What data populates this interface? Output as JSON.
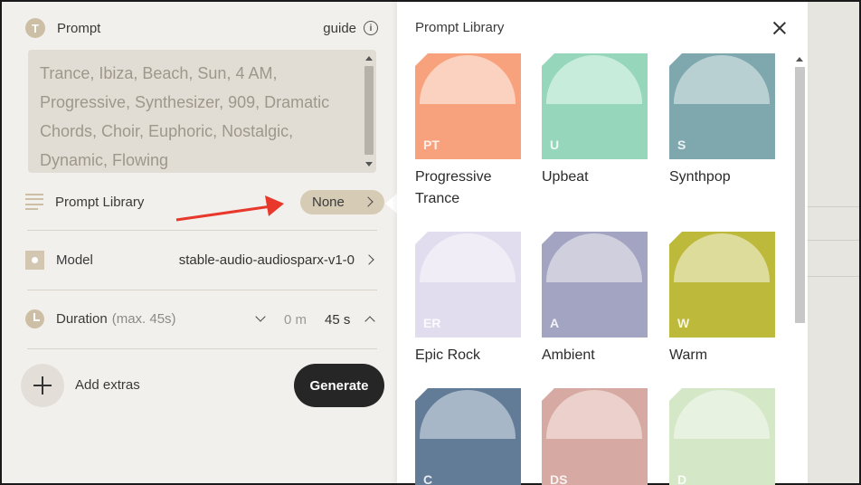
{
  "prompt": {
    "icon": "T",
    "label": "Prompt",
    "guide_label": "guide",
    "placeholder": "Trance, Ibiza, Beach, Sun, 4 AM, Progressive, Synthesizer, 909, Dramatic Chords, Choir, Euphoric, Nostalgic, Dynamic, Flowing"
  },
  "prompt_library_row": {
    "label": "Prompt Library",
    "value": "None"
  },
  "model": {
    "label": "Model",
    "value": "stable-audio-audiosparx-v1-0"
  },
  "duration": {
    "label": "Duration",
    "hint": "(max. 45s)",
    "minutes": "0 m",
    "seconds": "45 s"
  },
  "extras": {
    "label": "Add extras"
  },
  "generate": {
    "label": "Generate"
  },
  "library": {
    "title": "Prompt Library",
    "tiles": [
      {
        "abbr": "PT",
        "name": "Progressive Trance",
        "color": "#f7a27c",
        "dome": "#fbd2bf"
      },
      {
        "abbr": "U",
        "name": "Upbeat",
        "color": "#96d7bb",
        "dome": "#c8ecdb"
      },
      {
        "abbr": "S",
        "name": "Synthpop",
        "color": "#7fa7ae",
        "dome": "#b9d0d3"
      },
      {
        "abbr": "ER",
        "name": "Epic Rock",
        "color": "#e2dcef",
        "dome": "#f0edf6"
      },
      {
        "abbr": "A",
        "name": "Ambient",
        "color": "#a3a3c2",
        "dome": "#cfcfde"
      },
      {
        "abbr": "W",
        "name": "Warm",
        "color": "#bdb93a",
        "dome": "#dedc9b"
      },
      {
        "abbr": "C",
        "name": "",
        "color": "#627c98",
        "dome": "#a7b7c8"
      },
      {
        "abbr": "DS",
        "name": "",
        "color": "#d6a9a2",
        "dome": "#ebd0cb"
      },
      {
        "abbr": "D",
        "name": "",
        "color": "#d4e7c7",
        "dome": "#e8f2e1"
      }
    ]
  }
}
